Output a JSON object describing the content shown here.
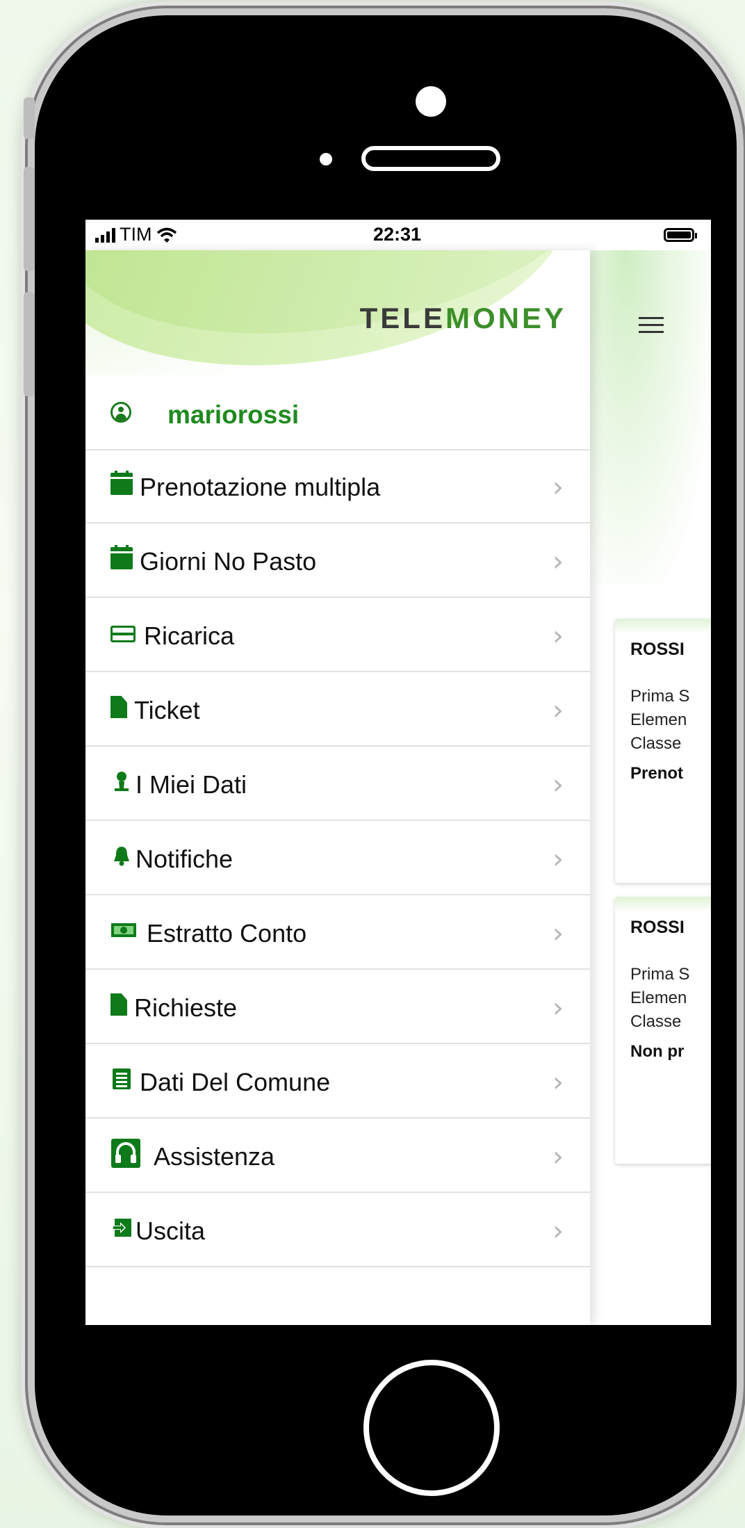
{
  "statusbar": {
    "carrier": "TIM",
    "time": "22:31"
  },
  "drawer": {
    "logo_part1": "TELE",
    "logo_part2": "MONEY",
    "username": "mariorossi",
    "items": [
      {
        "label": "Prenotazione multipla",
        "icon": "calendar-icon"
      },
      {
        "label": "Giorni No Pasto",
        "icon": "calendar-icon"
      },
      {
        "label": "Ricarica",
        "icon": "credit-card-icon"
      },
      {
        "label": "Ticket",
        "icon": "document-icon"
      },
      {
        "label": "I Miei Dati",
        "icon": "user-icon"
      },
      {
        "label": "Notifiche",
        "icon": "bell-icon"
      },
      {
        "label": "Estratto Conto",
        "icon": "money-icon"
      },
      {
        "label": "Richieste",
        "icon": "document-icon"
      },
      {
        "label": "Dati Del Comune",
        "icon": "list-icon"
      },
      {
        "label": "Assistenza",
        "icon": "headset-icon"
      },
      {
        "label": "Uscita",
        "icon": "exit-icon"
      }
    ],
    "chevron": "›"
  },
  "main": {
    "cards": [
      {
        "name": "ROSSI",
        "line1": "Prima S",
        "line2": "Elemen",
        "line3": "Classe",
        "status": "Prenot"
      },
      {
        "name": "ROSSI",
        "line1": "Prima S",
        "line2": "Elemen",
        "line3": "Classe",
        "status": "Non pr"
      }
    ]
  },
  "colors": {
    "brand_green": "#1f8a1f",
    "icon_green": "#0e7a1a",
    "logo_gray": "#3a3a3a"
  }
}
